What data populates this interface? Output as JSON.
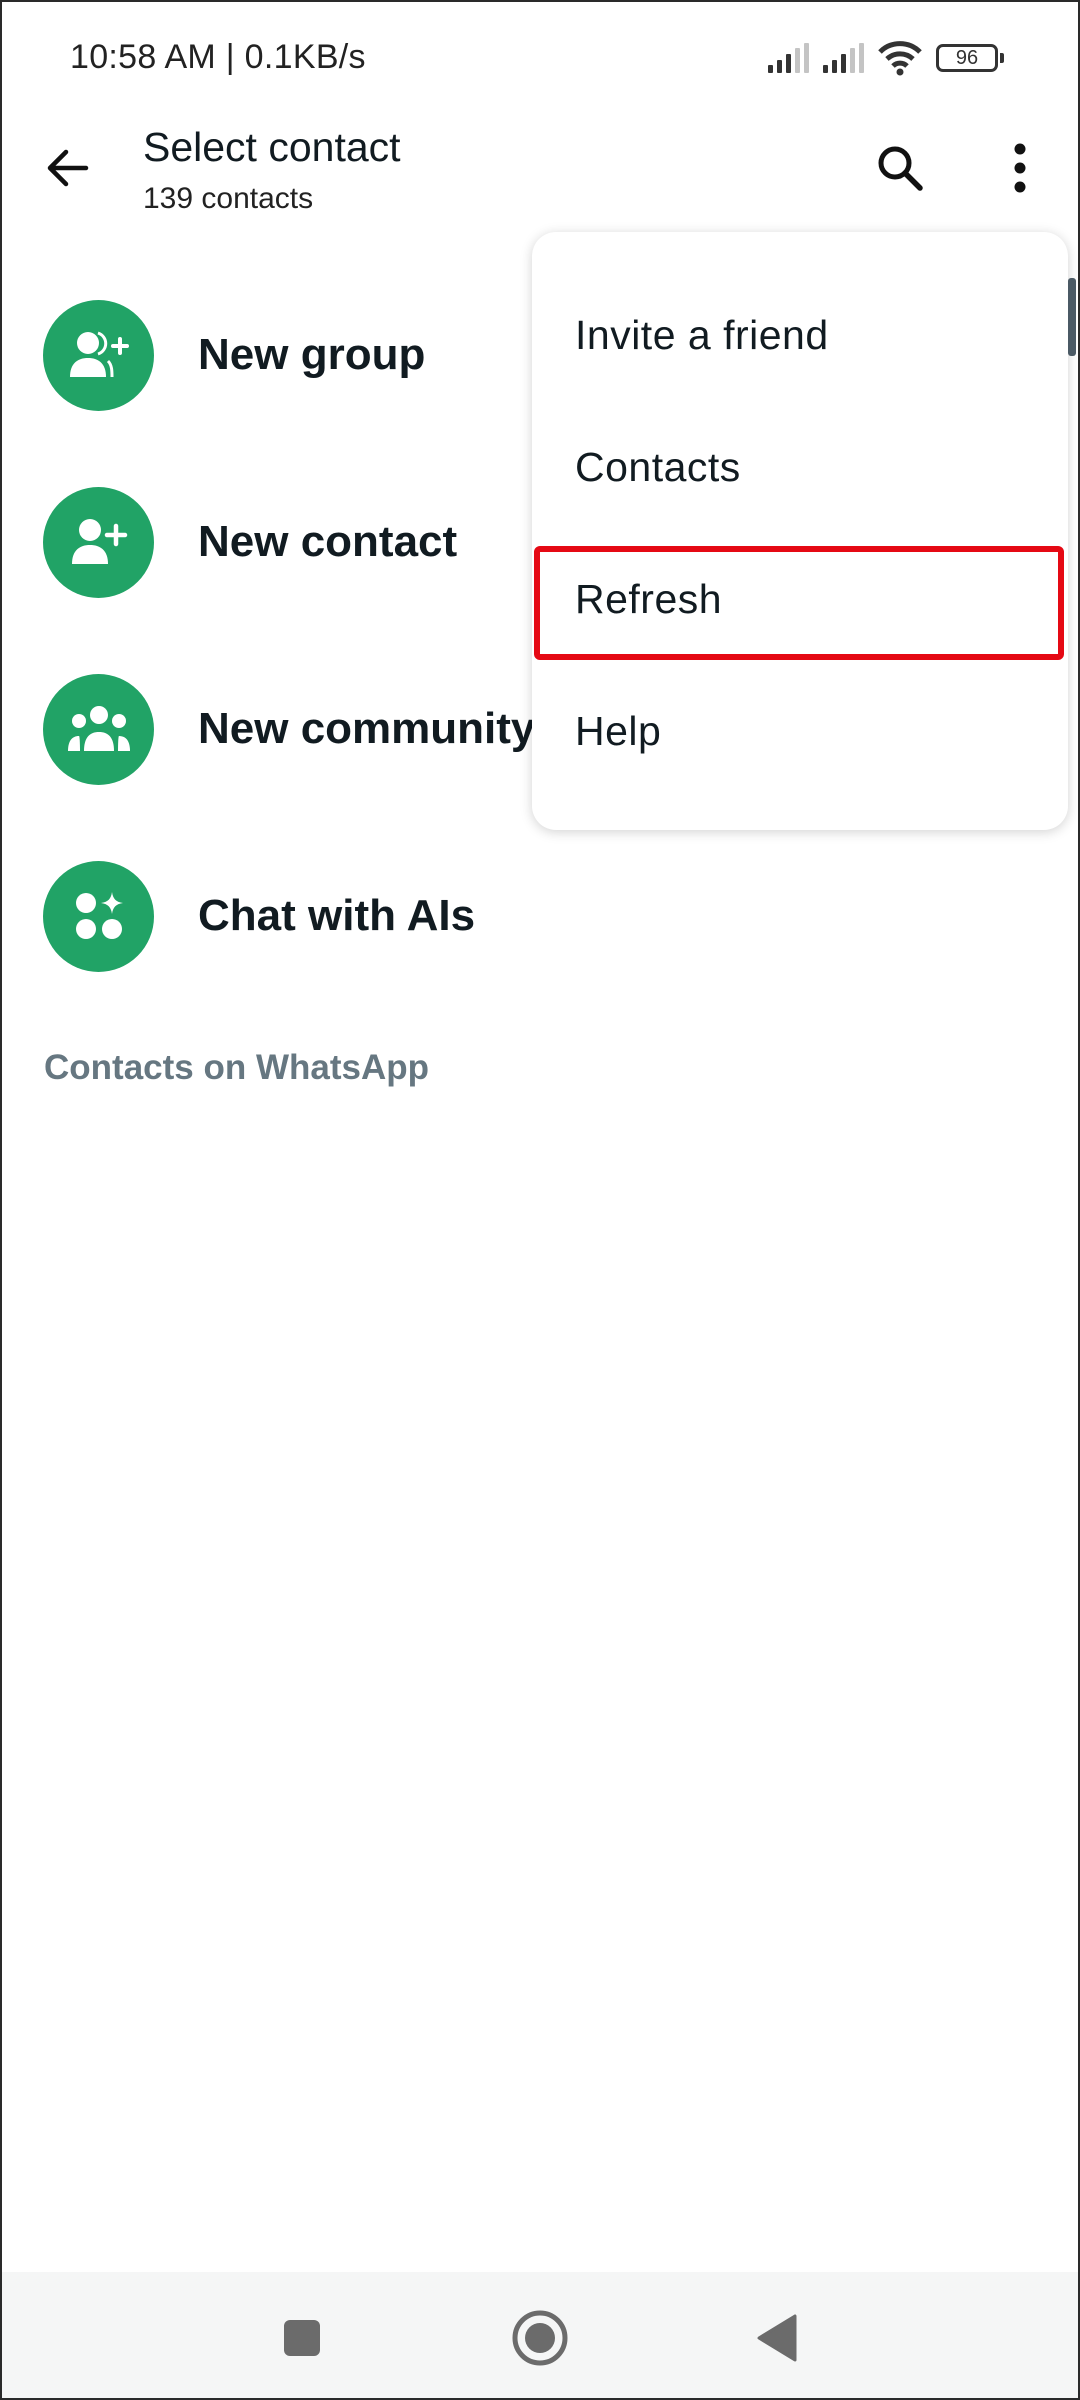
{
  "status_bar": {
    "time_and_speed": "10:58 AM | 0.1KB/s",
    "battery_level": "96",
    "icons": [
      "signal-icon",
      "signal-icon",
      "wifi-icon",
      "battery-icon"
    ]
  },
  "app_bar": {
    "title": "Select contact",
    "subtitle": "139 contacts",
    "icons": [
      "back-arrow-icon",
      "search-icon",
      "more-vert-icon"
    ]
  },
  "actions": [
    {
      "label": "New group",
      "icon": "group-add-icon"
    },
    {
      "label": "New contact",
      "icon": "person-add-icon"
    },
    {
      "label": "New community",
      "icon": "community-icon"
    },
    {
      "label": "Chat with AIs",
      "icon": "ai-sparkle-icon"
    }
  ],
  "section_header": "Contacts on WhatsApp",
  "overflow_menu": {
    "items": [
      {
        "label": "Invite a friend"
      },
      {
        "label": "Contacts"
      },
      {
        "label": "Refresh",
        "highlighted": true
      },
      {
        "label": "Help"
      }
    ]
  },
  "colors": {
    "accent_green": "#21a366",
    "highlight_red": "#e50914",
    "section_grey": "#667781"
  },
  "nav_bar": {
    "icons": [
      "recents-square-icon",
      "home-circle-icon",
      "back-triangle-icon"
    ]
  }
}
